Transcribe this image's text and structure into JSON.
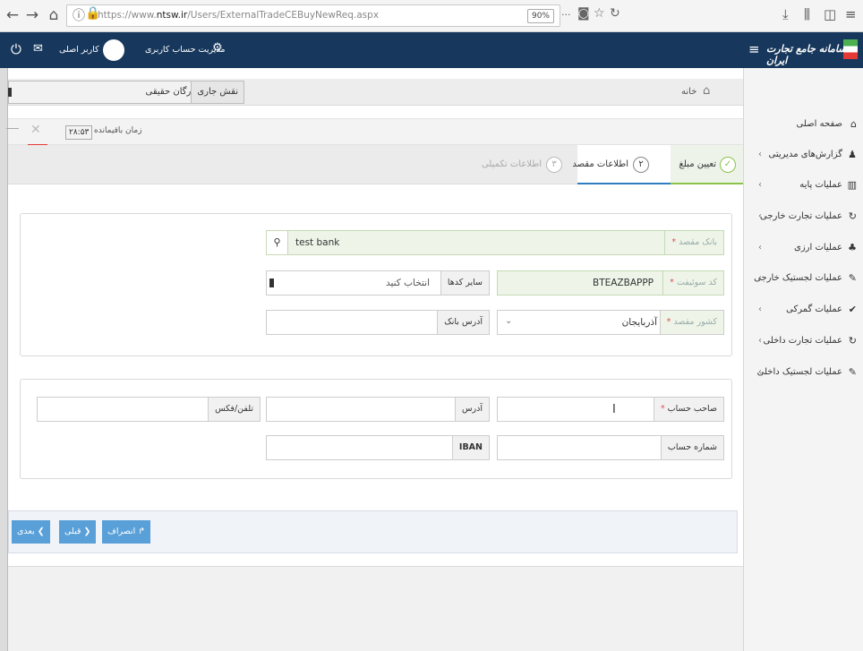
{
  "browser": {
    "url_prefix": "https://www.",
    "url_domain": "ntsw.ir",
    "url_path": "/Users/ExternalTradeCEBuyNewReq.aspx",
    "zoom": "90%",
    "more_icon": "···"
  },
  "header": {
    "user_name": "کاربر اصلی",
    "account_management": "مدیریت حساب کاربری",
    "app_title": "سامانه جامع تجارت ایران"
  },
  "breadcrumb": {
    "home": "خانه"
  },
  "role": {
    "label": "نقش جاری",
    "value": "بازرگان حقیقی"
  },
  "timer": {
    "label": "زمان باقیمانده",
    "value": "۲۸:۵۳"
  },
  "wizard": {
    "steps": [
      {
        "label": "تعیین مبلغ"
      },
      {
        "num": "۲",
        "label": "اطلاعات مقصد"
      },
      {
        "num": "۳",
        "label": "اطلاعات تکمیلی"
      }
    ]
  },
  "form": {
    "dest_bank_label": "بانک مقصد",
    "dest_bank_value": "test bank",
    "swift_label": "کد سوئیفت",
    "swift_value": "BTEAZBAPPP",
    "other_codes_label": "سایر کدها",
    "other_codes_value": "انتخاب کنید",
    "dest_country_label": "کشور مقصد",
    "dest_country_value": "آذربایجان",
    "bank_address_label": "آدرس بانک",
    "account_holder_label": "صاحب حساب",
    "address_label": "آدرس",
    "phone_fax_label": "تلفن/فکس",
    "account_number_label": "شماره حساب",
    "iban_label": "IBAN"
  },
  "buttons": {
    "cancel": "انصراف",
    "prev": "قبلی",
    "next": "بعدی"
  },
  "sidebar": {
    "items": [
      {
        "label": "صفحه اصلی",
        "icon": "home-icon"
      },
      {
        "label": "گزارش‌های مدیریتی",
        "icon": "user-icon"
      },
      {
        "label": "عملیات پایه",
        "icon": "chart-icon"
      },
      {
        "label": "عملیات تجارت خارجی",
        "icon": "refresh-icon"
      },
      {
        "label": "عملیات ارزی",
        "icon": "users-icon"
      },
      {
        "label": "عملیات لجستیک خارجی",
        "icon": "edit-icon"
      },
      {
        "label": "عملیات گمرکی",
        "icon": "check-icon"
      },
      {
        "label": "عملیات تجارت داخلی",
        "icon": "refresh-icon"
      },
      {
        "label": "عملیات لجستیک داخلی",
        "icon": "edit-icon"
      }
    ]
  }
}
